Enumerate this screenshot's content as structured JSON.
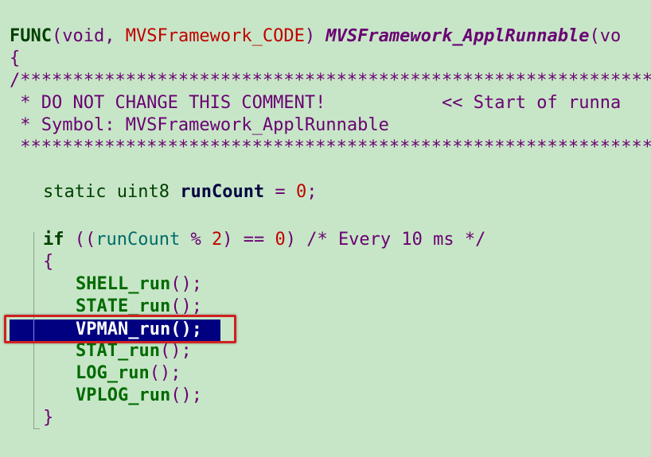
{
  "code": {
    "line_func": {
      "func": "FUNC",
      "open": "(",
      "void": "void",
      "comma": ", ",
      "code_macro": "MVSFramework_CODE",
      "close": ") ",
      "name": "MVSFramework_ApplRunnable",
      "rest": "(vo"
    },
    "line_brace_open": "{",
    "line_stars_top": "/*****************************************************************",
    "line_comment_1": " * DO NOT CHANGE THIS COMMENT!           << Start of runna",
    "line_comment_2": " * Symbol: MVSFramework_ApplRunnable",
    "line_stars_bottom": " *****************************************************************",
    "line_static": {
      "static": "static",
      "type": "uint8",
      "var": "runCount",
      "assign": " = ",
      "value": "0",
      "semi": ";"
    },
    "line_if": {
      "if": "if",
      "open": " ((",
      "var": "runCount",
      "op": " % ",
      "two": "2",
      "mid": ") == ",
      "zero": "0",
      "close": ") ",
      "comment": "/* Every 10 ms */"
    },
    "line_block_open": "{",
    "calls": [
      {
        "name": "SHELL_run",
        "tail": "();"
      },
      {
        "name": "STATE_run",
        "tail": "();"
      },
      {
        "name": "VPMAN_run",
        "tail": "();"
      },
      {
        "name": "STAT_run",
        "tail": "();"
      },
      {
        "name": "LOG_run",
        "tail": "();"
      },
      {
        "name": "VPLOG_run",
        "tail": "();"
      }
    ],
    "line_block_close": "}",
    "selected_line": "VPMAN_run();"
  },
  "colors": {
    "background": "#c7e6c7",
    "selection": "#000080",
    "highlight_box": "#d02020"
  }
}
